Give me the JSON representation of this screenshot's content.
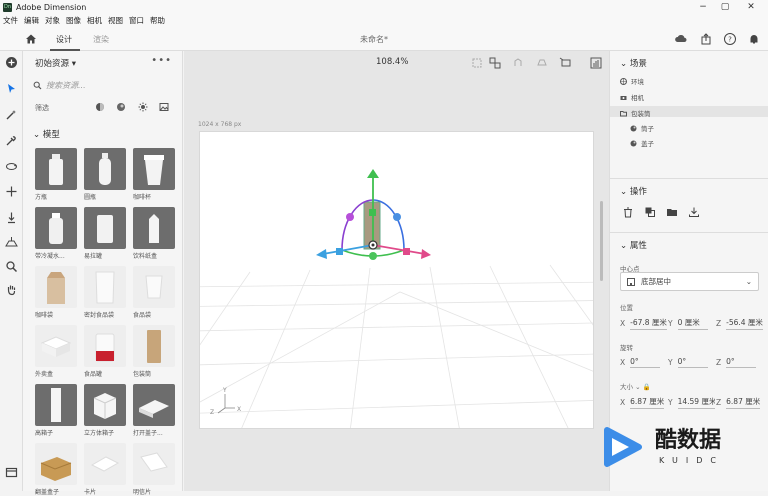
{
  "window": {
    "title": "Adobe Dimension",
    "logo": "Dn",
    "controls": [
      "−",
      "▢",
      "✕"
    ]
  },
  "menu": [
    "文件",
    "编辑",
    "对象",
    "图像",
    "相机",
    "视图",
    "窗口",
    "帮助"
  ],
  "tabs": {
    "design": "设计",
    "render": "渲染"
  },
  "doc_title": "未命名*",
  "zoom": "108.4%",
  "assets": {
    "title": "初始资源",
    "search_placeholder": "搜索资源...",
    "filter_label": "筛选",
    "section": "模型",
    "items": [
      {
        "label": "方瓶"
      },
      {
        "label": "圆瓶"
      },
      {
        "label": "咖啡杯"
      },
      {
        "label": "带冷凝水..."
      },
      {
        "label": "易拉罐"
      },
      {
        "label": "饮料纸盒"
      },
      {
        "label": "咖啡袋"
      },
      {
        "label": "密封食品袋"
      },
      {
        "label": "食品袋"
      },
      {
        "label": "外卖盒"
      },
      {
        "label": "食品罐"
      },
      {
        "label": "包装筒"
      },
      {
        "label": "高箱子"
      },
      {
        "label": "立方体箱子"
      },
      {
        "label": "打开盖子..."
      },
      {
        "label": "翻盖盒子"
      },
      {
        "label": "卡片"
      },
      {
        "label": "明信片"
      }
    ]
  },
  "canvas": {
    "size_label": "1024 x 768 px",
    "axis_labels": {
      "y": "Y",
      "z": "Z",
      "x": "X"
    }
  },
  "scene": {
    "title": "场景",
    "items": [
      {
        "label": "环境",
        "indent": 0
      },
      {
        "label": "相机",
        "indent": 0
      },
      {
        "label": "包装筒",
        "indent": 0,
        "selected": true
      },
      {
        "label": "筒子",
        "indent": 1
      },
      {
        "label": "盖子",
        "indent": 1
      }
    ]
  },
  "actions": {
    "title": "操作"
  },
  "properties": {
    "title": "属性",
    "center_label": "中心点",
    "center_value": "底部居中",
    "position_label": "位置",
    "position": {
      "x": "-67.8 厘米",
      "y": "0 厘米",
      "z": "-56.4 厘米"
    },
    "rotation_label": "旋转",
    "rotation": {
      "x": "0°",
      "y": "0°",
      "z": "0°"
    },
    "size_label": "大小",
    "size": {
      "x": "6.87 厘米",
      "y": "14.59 厘米",
      "z": "6.87 厘米"
    }
  },
  "watermark": {
    "text": "酷数据",
    "sub": "KUIDC"
  },
  "colors": {
    "gizmo_y": "#3fbf4f",
    "gizmo_x": "#e04a8a",
    "gizmo_z": "#3aa0e0",
    "arc_rot": "#8a3fd0",
    "accent": "#1473e6"
  }
}
